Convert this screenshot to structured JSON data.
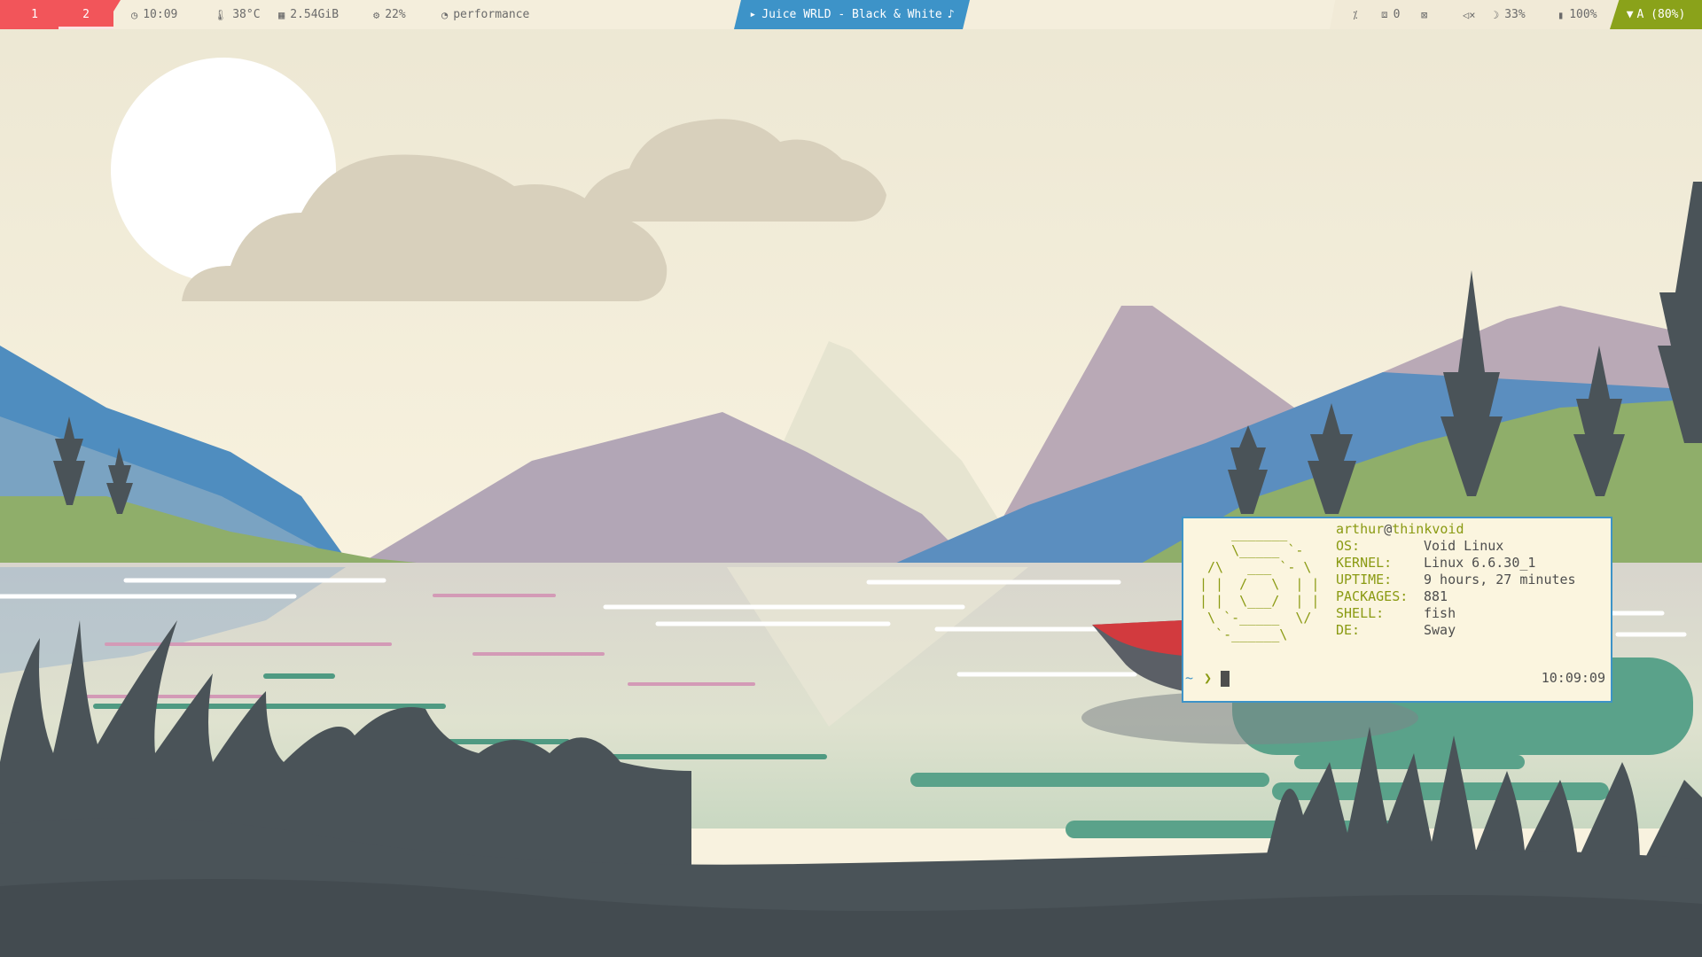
{
  "workspaces": [
    {
      "label": "1",
      "active": false
    },
    {
      "label": "2",
      "active": true
    }
  ],
  "stats": {
    "time": "10:09",
    "temperature": "38°C",
    "memory": "2.54GiB",
    "cpu": "22%",
    "power_profile": "performance"
  },
  "media": {
    "play_glyph": "▸",
    "track": "Juice WRLD - Black & White",
    "note_glyph": "♪"
  },
  "tray": {
    "updates_count": "0",
    "volume_glyph": "🔇",
    "brightness": "33%",
    "battery": "100%",
    "network": "A (80%)"
  },
  "icons": {
    "clock": "clock-icon",
    "temperature": "thermometer-icon",
    "memory": "memory-icon",
    "cpu": "cpu-icon",
    "power": "speedometer-icon",
    "idle": "no-sleep-icon",
    "updates": "package-icon",
    "notifications": "notification-icon",
    "volume": "volume-muted-icon",
    "brightness": "moon-icon",
    "battery": "battery-icon",
    "wifi": "wifi-icon"
  },
  "terminal": {
    "ascii_logo": "    _______\n    \\_____ `-\n /\\   ___ `- \\\n| |  /   \\  | |\n| |  \\___/  | |\n \\ `-_____  \\/\n  `-______\\",
    "user": "arthur",
    "at": "@",
    "host": "thinkvoid",
    "info": [
      {
        "key": "OS:",
        "value": "Void Linux"
      },
      {
        "key": "KERNEL:",
        "value": "Linux 6.6.30_1"
      },
      {
        "key": "UPTIME:",
        "value": "9 hours, 27 minutes"
      },
      {
        "key": "PACKAGES:",
        "value": "881"
      },
      {
        "key": "SHELL:",
        "value": "fish"
      },
      {
        "key": "DE:",
        "value": "Sway"
      }
    ],
    "prompt_dir": "~",
    "prompt_symbol": "❯",
    "clock": "10:09:09"
  },
  "colors": {
    "workspace": "#f2555a",
    "media": "#3d93c8",
    "network": "#8aa21a",
    "terminal_border": "#3d93c8",
    "terminal_bg": "#fbf5df",
    "accent_green": "#8a9a12"
  }
}
